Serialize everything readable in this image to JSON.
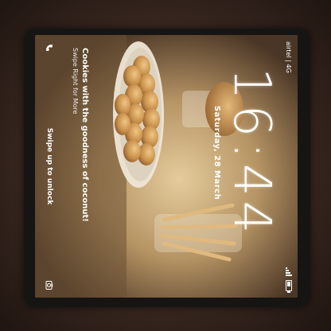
{
  "status_bar": {
    "carrier": "airtel | 4G",
    "signal_icon": "signal-icon",
    "battery_icon": "battery-icon",
    "battery_level": 0.6
  },
  "lock_screen": {
    "time": "16:44",
    "date": "Saturday, 28 March",
    "caption_title": "Cookies with the goodness of coconut!",
    "caption_subtitle": "Swipe Right for More",
    "unlock_hint": "Swipe up to unlock",
    "left_icon": "phone-icon",
    "right_icon": "camera-icon"
  },
  "colors": {
    "text": "#ffffff",
    "bezel": "#161514",
    "background": "#2e1f18"
  }
}
